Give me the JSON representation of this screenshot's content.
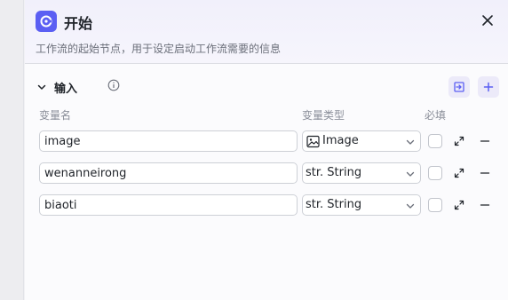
{
  "panel": {
    "title": "开始",
    "description": "工作流的起始节点，用于设定启动工作流需要的信息",
    "close_icon": "close-icon",
    "node_icon": "start-node-icon"
  },
  "input_section": {
    "label": "输入",
    "info_icon": "info-icon",
    "collapse_icon": "chevron-down-icon",
    "import_icon": "import-icon",
    "add_icon": "plus-icon",
    "columns": {
      "name": "变量名",
      "type": "变量类型",
      "required": "必填"
    },
    "rows": [
      {
        "name": "image",
        "type": "Image",
        "type_icon": "image-icon",
        "required": false
      },
      {
        "name": "wenanneirong",
        "type": "str. String",
        "type_icon": "",
        "required": false
      },
      {
        "name": "biaoti",
        "type": "str. String",
        "type_icon": "",
        "required": false
      }
    ]
  },
  "colors": {
    "accent": "#5b5ff3",
    "header_bg": "#f1f0fb",
    "border": "#cdd0d6",
    "muted_text": "#8a8e99"
  }
}
